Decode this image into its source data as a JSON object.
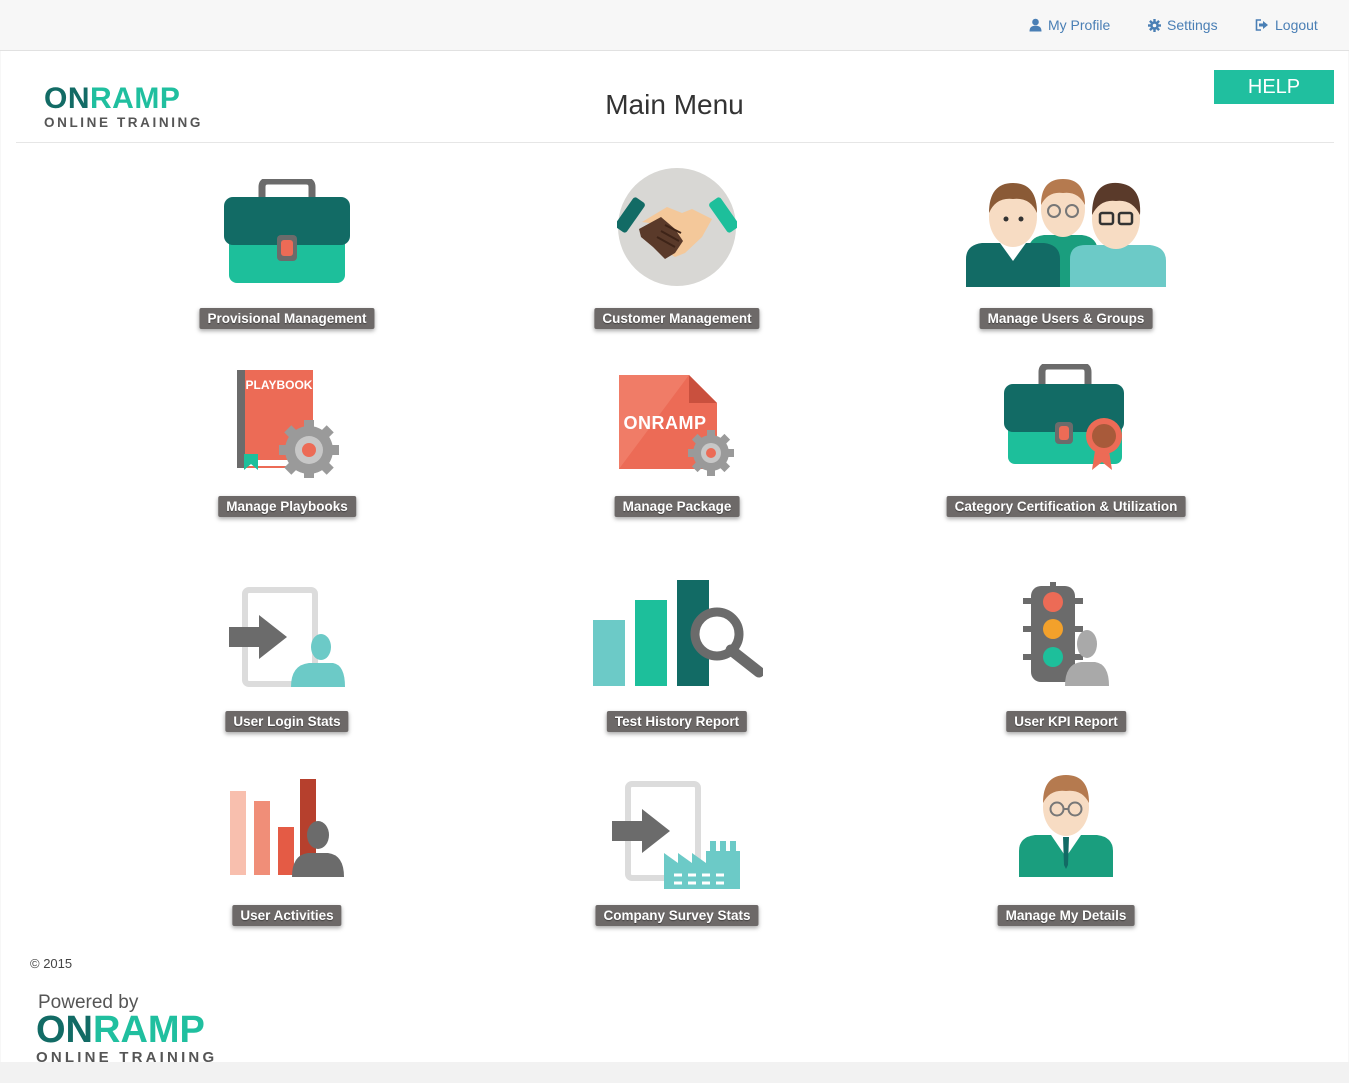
{
  "nav": {
    "profile": "My Profile",
    "settings": "Settings",
    "logout": "Logout"
  },
  "logo": {
    "on": "ON",
    "ramp": "RAMP",
    "sub": "ONLINE TRAINING"
  },
  "page": {
    "title": "Main Menu",
    "help": "HELP"
  },
  "tiles": [
    {
      "label": "Provisional Management",
      "icon": "briefcase-icon"
    },
    {
      "label": "Customer Management",
      "icon": "handshake-icon"
    },
    {
      "label": "Manage Users & Groups",
      "icon": "users-group-icon"
    },
    {
      "label": "Manage Playbooks",
      "icon": "playbook-gear-icon",
      "icon_text": "PLAYBOOK"
    },
    {
      "label": "Manage Package",
      "icon": "package-gear-icon",
      "icon_text": "ONRAMP"
    },
    {
      "label": "Category Certification & Utilization",
      "icon": "briefcase-certificate-icon"
    },
    {
      "label": "User Login Stats",
      "icon": "user-login-icon"
    },
    {
      "label": "Test History Report",
      "icon": "bar-chart-search-icon"
    },
    {
      "label": "User KPI Report",
      "icon": "traffic-light-user-icon"
    },
    {
      "label": "User Activities",
      "icon": "bar-chart-user-icon"
    },
    {
      "label": "Company Survey Stats",
      "icon": "company-login-icon"
    },
    {
      "label": "Manage My Details",
      "icon": "user-details-icon"
    }
  ],
  "footer": {
    "copyright": "© 2015",
    "powered_by": "Powered by",
    "on": "ON",
    "ramp": "RAMP",
    "sub": "ONLINE TRAINING"
  },
  "colors": {
    "accent": "#20bf9f",
    "dark_teal": "#126b65",
    "coral": "#ec6b56",
    "label_bg": "#6d6968",
    "link": "#4a7fb5"
  }
}
